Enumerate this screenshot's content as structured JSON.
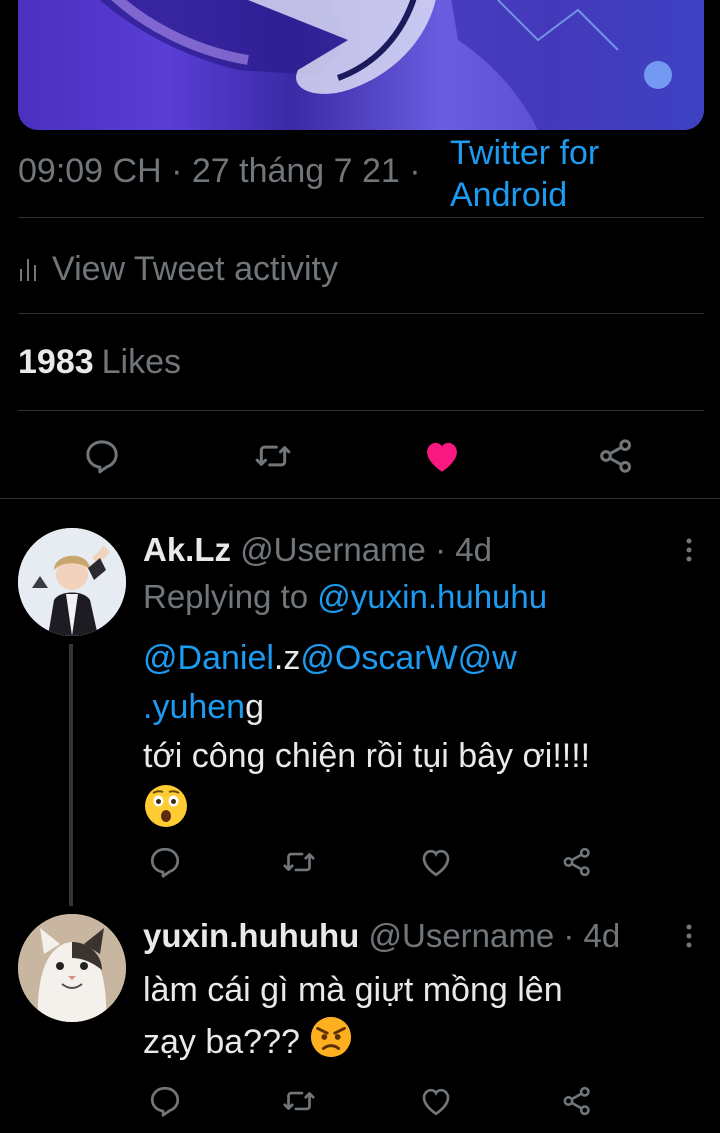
{
  "tweet": {
    "timestamp": "09:09 CH · 27 tháng 7 21 ·",
    "source_line1": "Twitter for",
    "source_line2": "Android",
    "activity_label": "View Tweet activity",
    "likes_count": "1983",
    "likes_label": "Likes",
    "liked": true
  },
  "replies": [
    {
      "name": "Ak.Lz",
      "handle": "@Username · 4d",
      "replying_prefix": "Replying to",
      "replying_to": "@yuxin.huhuhu",
      "mention_line1": "@Daniel",
      "mention_line1_tail": ".z",
      "mention_line1_b": "@OscarW@w",
      "mention_line2": ".yuhen",
      "mention_line2_tail": "g",
      "text": "tới công chiện rồi tụi bây ơi!!!!",
      "emoji": "astonished-face"
    },
    {
      "name": "yuxin.huhuhu",
      "handle": "@Username · 4d",
      "text_line1": "làm cái gì mà giựt mồng lên",
      "text_line2": "zạy ba???",
      "emoji": "angry-face"
    }
  ],
  "colors": {
    "background": "#000000",
    "text": "#e7e9ea",
    "secondary": "#71767b",
    "link": "#1d9bf0",
    "like": "#f91880",
    "divider": "#2f3336"
  },
  "icons": [
    "reply-icon",
    "retweet-icon",
    "like-icon",
    "share-icon",
    "more-icon",
    "activity-icon"
  ]
}
